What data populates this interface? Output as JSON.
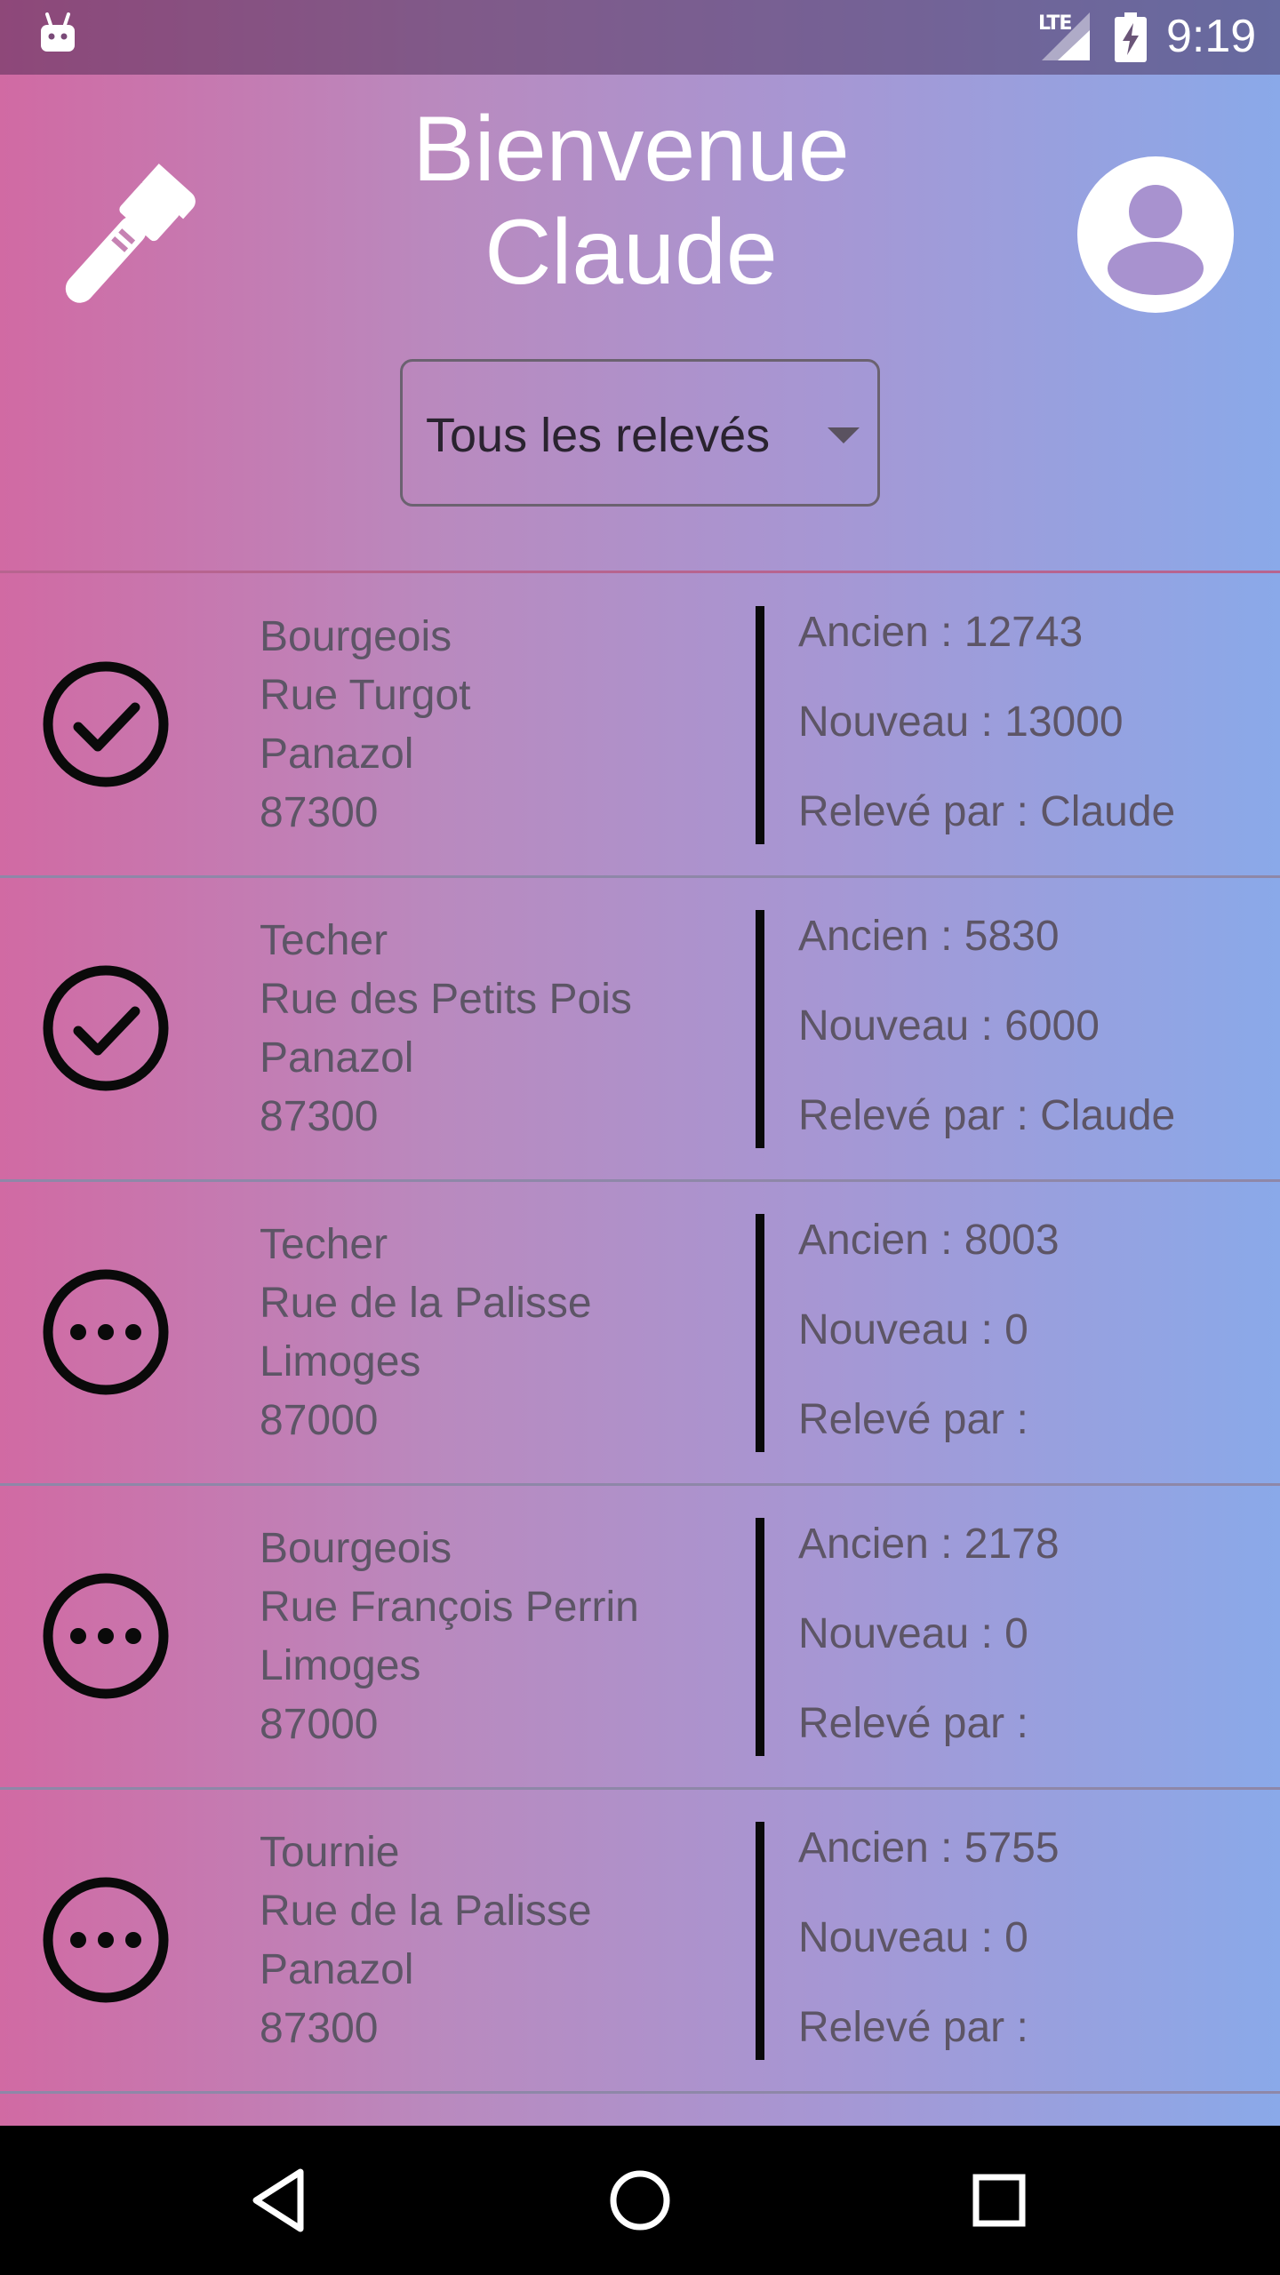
{
  "status_bar": {
    "network_label": "LTE",
    "time": "9:19",
    "icons": [
      "android-icon",
      "signal-icon",
      "battery-charging-icon"
    ]
  },
  "header": {
    "welcome_line1": "Bienvenue",
    "welcome_line2": "Claude",
    "logo_icon": "wrench-icon",
    "profile_icon": "account-circle-icon"
  },
  "filter": {
    "selected": "Tous les relevés"
  },
  "list": {
    "rows": [
      {
        "status": "done",
        "status_icon": "check-circle-icon",
        "name": "Bourgeois",
        "street": "Rue Turgot",
        "city": "Panazol",
        "postcode": "87300",
        "ancien": "Ancien : 12743",
        "nouveau": "Nouveau : 13000",
        "releve_par": "Relevé par : Claude"
      },
      {
        "status": "done",
        "status_icon": "check-circle-icon",
        "name": "Techer",
        "street": "Rue des Petits Pois",
        "city": "Panazol",
        "postcode": "87300",
        "ancien": "Ancien : 5830",
        "nouveau": "Nouveau : 6000",
        "releve_par": "Relevé par : Claude"
      },
      {
        "status": "pending",
        "status_icon": "more-circle-icon",
        "name": "Techer",
        "street": "Rue de la Palisse",
        "city": "Limoges",
        "postcode": "87000",
        "ancien": "Ancien : 8003",
        "nouveau": "Nouveau : 0",
        "releve_par": "Relevé par :"
      },
      {
        "status": "pending",
        "status_icon": "more-circle-icon",
        "name": "Bourgeois",
        "street": "Rue François Perrin",
        "city": "Limoges",
        "postcode": "87000",
        "ancien": "Ancien : 2178",
        "nouveau": "Nouveau : 0",
        "releve_par": "Relevé par :"
      },
      {
        "status": "pending",
        "status_icon": "more-circle-icon",
        "name": "Tournie",
        "street": "Rue de la Palisse",
        "city": "Panazol",
        "postcode": "87300",
        "ancien": "Ancien : 5755",
        "nouveau": "Nouveau : 0",
        "releve_par": "Relevé par :"
      }
    ]
  },
  "nav_bar": {
    "buttons": [
      "back-icon",
      "home-icon",
      "recents-icon"
    ]
  },
  "colors": {
    "gradient_left": "#d16aa3",
    "gradient_right": "#8aa9e9",
    "text": "#5d5566",
    "icon": "#0a0a0a"
  }
}
